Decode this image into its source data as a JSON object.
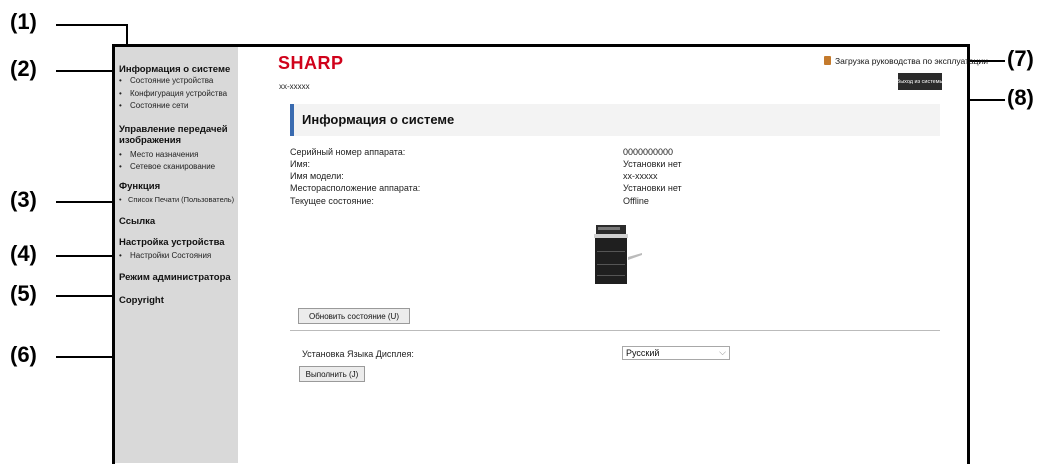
{
  "callouts": {
    "c1": "(1)",
    "c2": "(2)",
    "c3": "(3)",
    "c4": "(4)",
    "c5": "(5)",
    "c6": "(6)",
    "c7": "(7)",
    "c8": "(8)"
  },
  "header": {
    "logo": "SHARP",
    "model": "xx-xxxxx",
    "download_manual": "Загрузка руководства по эксплуатации",
    "logout": "Выход из системы"
  },
  "sidebar": {
    "system_info": "Информация о системе",
    "device_status": "Состояние устройства",
    "device_config": "Конфигурация устройства",
    "network_status": "Состояние сети",
    "image_send": "Управление передачей изображения",
    "destination": "Место назначения",
    "network_scan": "Сетевое сканирование",
    "function": "Функция",
    "print_list": "Список Печати (Пользователь)",
    "link": "Ссылка",
    "device_settings": "Настройка устройства",
    "status_settings": "Настройки Состояния",
    "admin_mode": "Режим администратора",
    "copyright": "Copyright"
  },
  "main": {
    "title": "Информация о системе",
    "rows": [
      {
        "label": "Серийный номер аппарата:",
        "value": "0000000000"
      },
      {
        "label": "Имя:",
        "value": "Установки нет"
      },
      {
        "label": "Имя модели:",
        "value": "xx-xxxxx"
      },
      {
        "label": "Месторасположение аппарата:",
        "value": "Установки нет"
      },
      {
        "label": "Текущее состояние:",
        "value": "Offline"
      }
    ],
    "refresh_button": "Обновить состояние (U)",
    "language_label": "Установка Языка Дисплея:",
    "language_value": "Русский",
    "execute_button": "Выполнить (J)"
  }
}
